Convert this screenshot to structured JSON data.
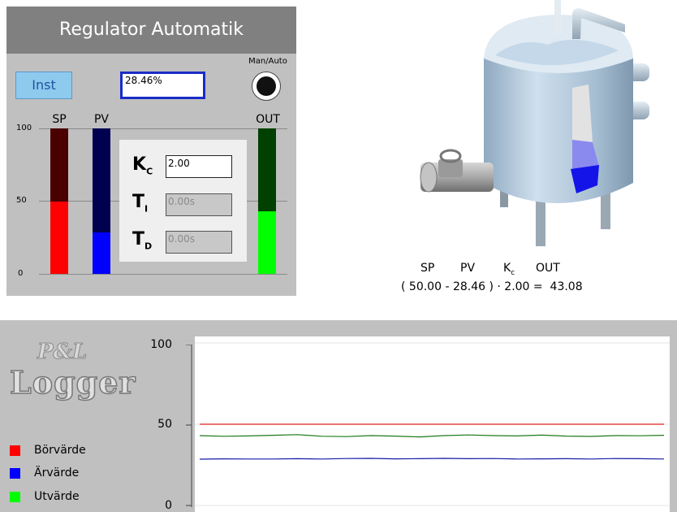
{
  "regulator": {
    "title": "Regulator Automatik",
    "inst_button": "Inst",
    "output_value": "28.46%",
    "man_auto_label": "Man/Auto",
    "columns": {
      "sp": "SP",
      "pv": "PV",
      "out": "OUT"
    },
    "axis": {
      "max": "100",
      "mid": "50",
      "min": "0"
    },
    "bars": {
      "sp": {
        "level": 0.5,
        "bg": "#4a0000",
        "fill": "#ff0000"
      },
      "pv": {
        "level": 0.2846,
        "bg": "#000050",
        "fill": "#0000ff"
      },
      "out": {
        "level": 0.4308,
        "bg": "#004000",
        "fill": "#00ff00"
      }
    },
    "gains": {
      "kc": {
        "symbol": "K",
        "sub": "C",
        "value": "2.00"
      },
      "ti": {
        "symbol": "T",
        "sub": "I",
        "value": "0.00s"
      },
      "td": {
        "symbol": "T",
        "sub": "D",
        "value": "0.00s"
      }
    }
  },
  "equation": {
    "sp": "SP",
    "pv": "PV",
    "kc": "K",
    "kc_sub": "c",
    "out": "OUT",
    "expression": "( 50.00 - 28.46 ) · 2.00 =  43.08"
  },
  "logger": {
    "logo_top": "P&L",
    "logo_bottom": "Logger",
    "legend": [
      {
        "label": "Börvärde",
        "color": "#ff0000"
      },
      {
        "label": "Ärvärde",
        "color": "#0000ff"
      },
      {
        "label": "Utvärde",
        "color": "#00ff00"
      }
    ]
  },
  "chart_data": {
    "type": "line",
    "ylim": [
      0,
      100
    ],
    "yticks": [
      "100",
      "50",
      "0"
    ],
    "grid": true,
    "series": [
      {
        "name": "Börvärde",
        "color": "#e02020",
        "values": [
          50,
          50,
          50,
          50,
          50,
          50,
          50,
          50,
          50,
          50,
          50,
          50,
          50,
          50,
          50,
          50,
          50,
          50,
          50,
          50
        ]
      },
      {
        "name": "Ärvärde",
        "color": "#1a1aa8",
        "values": [
          28.5,
          28.7,
          28.6,
          28.6,
          28.8,
          28.6,
          28.9,
          29.0,
          28.7,
          28.8,
          29.0,
          28.8,
          28.9,
          28.6,
          28.7,
          28.8,
          28.6,
          28.9,
          28.8,
          28.6
        ]
      },
      {
        "name": "Utvärde",
        "color": "#1a7a1a",
        "values": [
          43.0,
          42.6,
          42.8,
          43.2,
          43.6,
          42.6,
          42.4,
          43.0,
          42.7,
          42.2,
          43.0,
          43.4,
          43.0,
          42.8,
          43.3,
          42.7,
          42.5,
          43.0,
          42.9,
          43.2
        ]
      }
    ]
  }
}
